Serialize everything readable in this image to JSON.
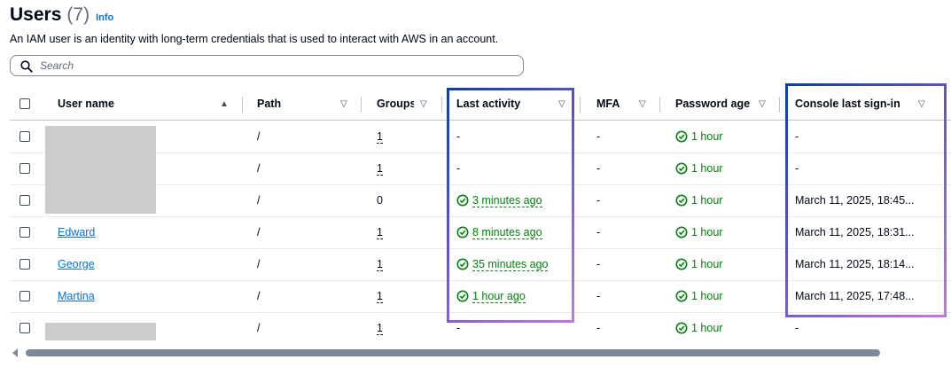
{
  "header": {
    "title": "Users",
    "count": "(7)",
    "info": "Info"
  },
  "description": "An IAM user is an identity with long-term credentials that is used to interact with AWS in an account.",
  "search": {
    "placeholder": "Search"
  },
  "columns": {
    "user_name": "User name",
    "path": "Path",
    "groups": "Groups",
    "last_activity": "Last activity",
    "mfa": "MFA",
    "password_age": "Password age",
    "console_last_signin": "Console last sign-in"
  },
  "rows": [
    {
      "user": "",
      "path": "/",
      "groups": "1",
      "last_activity": "-",
      "mfa": "-",
      "password_age": "1 hour",
      "console": "-"
    },
    {
      "user": "",
      "path": "/",
      "groups": "1",
      "last_activity": "-",
      "mfa": "-",
      "password_age": "1 hour",
      "console": "-"
    },
    {
      "user": "",
      "path": "/",
      "groups": "0",
      "last_activity": "3 minutes ago",
      "mfa": "-",
      "password_age": "1 hour",
      "console": "March 11, 2025, 18:45..."
    },
    {
      "user": "Edward",
      "path": "/",
      "groups": "1",
      "last_activity": "8 minutes ago",
      "mfa": "-",
      "password_age": "1 hour",
      "console": "March 11, 2025, 18:31..."
    },
    {
      "user": "George",
      "path": "/",
      "groups": "1",
      "last_activity": "35 minutes ago",
      "mfa": "-",
      "password_age": "1 hour",
      "console": "March 11, 2025, 18:14..."
    },
    {
      "user": "Martina",
      "path": "/",
      "groups": "1",
      "last_activity": "1 hour ago",
      "mfa": "-",
      "password_age": "1 hour",
      "console": "March 11, 2025, 17:48..."
    },
    {
      "user": "",
      "path": "/",
      "groups": "1",
      "last_activity": "-",
      "mfa": "-",
      "password_age": "1 hour",
      "console": "-"
    }
  ],
  "colors": {
    "link": "#0972d3",
    "success": "#037f0c",
    "highlight_start": "#0f3ea6",
    "highlight_end": "#c474e6",
    "redaction": "#cccccc"
  },
  "icons": {
    "search": "search-icon",
    "status": "check-circle-icon",
    "sort_asc": "sort-ascending-icon",
    "sort": "sort-icon"
  }
}
